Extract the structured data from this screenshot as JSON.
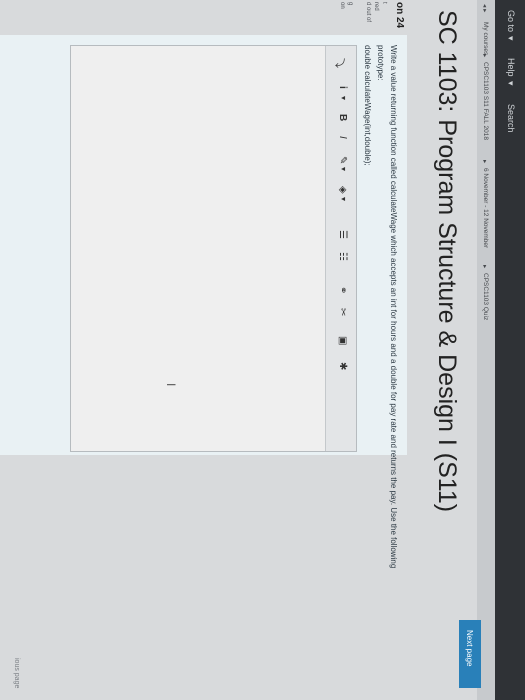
{
  "navbar": {
    "goto": "Go to",
    "help": "Help",
    "search": "Search"
  },
  "breadcrumb": [
    "My courses",
    "CPSC1103 S11 FALL 2018",
    "6 November - 12 November",
    "CPSC1103 Quiz"
  ],
  "page_title": "SC 1103: Program Structure & Design I (S11)",
  "question_info": {
    "number": "on 24",
    "state": "t",
    "answer_status": "red",
    "marks": "d out of",
    "flag": "g",
    "flag2": "on"
  },
  "question": {
    "line1": "Write a value returning function called calculateWage which accepts an int for hours and a double for pay rate and returns the pay. Use the following",
    "line2": "prototype:",
    "line3": "double calculateWage(int,double);"
  },
  "toolbar": {
    "expand": "⤵",
    "info": "i",
    "bold": "B",
    "italic": "I",
    "link": "🔗"
  },
  "editor_cursor": "I",
  "nav": {
    "previous": "ious page",
    "next": "Next page"
  },
  "colors": {
    "accent": "#2980b9",
    "navbar": "#2f3236"
  }
}
